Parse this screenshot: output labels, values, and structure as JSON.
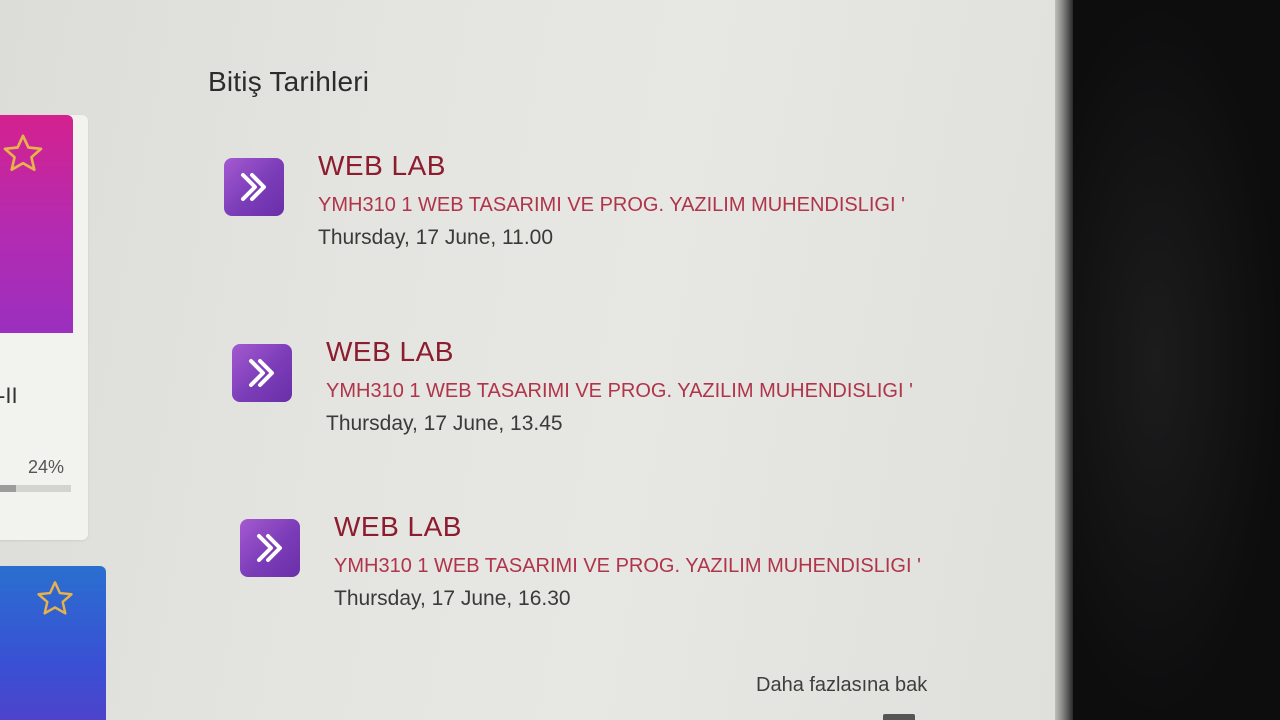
{
  "courses": [
    {
      "name_fragment": "-II",
      "progress_text": "24%",
      "progress": 0.24,
      "color_top": "#d4218f",
      "color_bottom": "#9b2fbf",
      "star_icon": "star-outline-icon"
    },
    {
      "color_top": "#2a6fd0",
      "color_bottom": "#5340c8",
      "star_icon": "star-outline-icon"
    }
  ],
  "deadlines": {
    "title": "Bitiş Tarihleri",
    "items": [
      {
        "name": "WEB LAB",
        "course": "YMH310 1 WEB TASARIMI VE PROG. YAZILIM MUHENDISLIGI '",
        "date": "Thursday, 17 June, 11.00",
        "icon": "assignment-chevron-icon"
      },
      {
        "name": "WEB LAB",
        "course": "YMH310 1 WEB TASARIMI VE PROG. YAZILIM MUHENDISLIGI '",
        "date": "Thursday, 17 June, 13.45",
        "icon": "assignment-chevron-icon"
      },
      {
        "name": "WEB LAB",
        "course": "YMH310 1 WEB TASARIMI VE PROG. YAZILIM MUHENDISLIGI '",
        "date": "Thursday, 17 June, 16.30",
        "icon": "assignment-chevron-icon"
      }
    ],
    "see_more": "Daha fazlasına bak"
  },
  "colors": {
    "accent_title": "#8c1c2e",
    "accent_course": "#b0344a",
    "icon_purple": "#7b3cb8"
  }
}
